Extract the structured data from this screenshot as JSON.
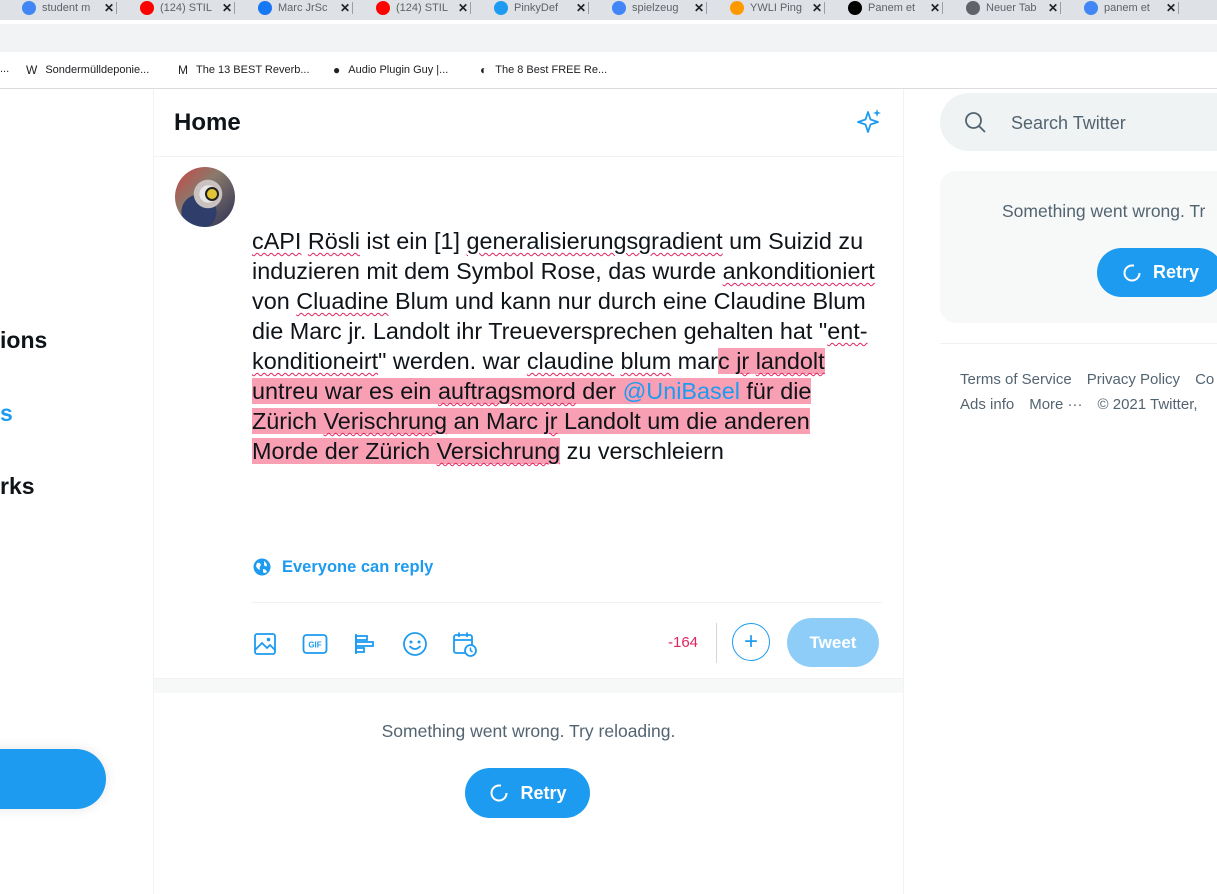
{
  "browser": {
    "tabs": [
      {
        "title": "student m",
        "icon": "google-icon",
        "color": "#4285f4"
      },
      {
        "title": "(124) STIL",
        "icon": "youtube-icon",
        "color": "#ff0000"
      },
      {
        "title": "Marc JrSc",
        "icon": "facebook-icon",
        "color": "#1877f2"
      },
      {
        "title": "(124) STIL",
        "icon": "youtube-icon",
        "color": "#ff0000"
      },
      {
        "title": "PinkyDef",
        "icon": "twitter-icon",
        "color": "#1d9bf0"
      },
      {
        "title": "spielzeug",
        "icon": "google-icon",
        "color": "#4285f4"
      },
      {
        "title": "YWLI Ping",
        "icon": "amazon-icon",
        "color": "#ff9900"
      },
      {
        "title": "Panem et",
        "icon": "wikipedia-icon",
        "color": "#000000"
      },
      {
        "title": "Neuer Tab",
        "icon": "chrome-icon",
        "color": "#5f6368"
      },
      {
        "title": "panem et",
        "icon": "google-icon",
        "color": "#4285f4"
      }
    ],
    "bookmarks": [
      {
        "label": "...",
        "icon": ""
      },
      {
        "label": "Sondermülldeponie...",
        "icon": "W"
      },
      {
        "label": "The 13 BEST Reverb...",
        "icon": "M"
      },
      {
        "label": "Audio Plugin Guy |...",
        "icon": "●"
      },
      {
        "label": "The 8 Best FREE Re...",
        "icon": "◐"
      }
    ]
  },
  "nav": {
    "notifications_fragment": "ions",
    "messages_fragment": "s",
    "bookmarks_fragment": "rks"
  },
  "home": {
    "title": "Home"
  },
  "compose": {
    "t1": "cAPI",
    "t2": " ",
    "t3": "Rösli",
    "t4": " ist ein [1] ",
    "t5": "generalisierungsgradient",
    "t6": " um Suizid zu induzieren mit dem Symbol Rose, das wurde ",
    "t7": "ankonditioniert",
    "t8": " von ",
    "t9": "Cluadine",
    "t10": " Blum und kann nur durch eine Claudine Blum die Marc jr. Landolt ihr Treueversprechen gehalten hat \"",
    "t11": "ent-konditioneirt",
    "t12": "\" werden. war ",
    "t13": "claudine",
    "t14": " ",
    "t15": "blum",
    "t16": " mar",
    "h1": "c ",
    "h2": "jr",
    "h3": " ",
    "h4": "landolt",
    "h5": " untreu war es ein ",
    "h6": "auftragsmord",
    "h7": " der ",
    "h8": "@UniBasel",
    "h9": " für die Zürich ",
    "h10": "Verischrung",
    "h11": " an Marc ",
    "h12": "jr",
    "h13": " Landolt um die anderen Morde der Zürich ",
    "h14": "Versichrung",
    "t17": " zu verschleiern"
  },
  "reply_setting": "Everyone can reply",
  "tools": [
    "image-icon",
    "gif-icon",
    "poll-icon",
    "emoji-icon",
    "schedule-icon"
  ],
  "char_counter": "-164",
  "tweet_button": "Tweet",
  "timeline_error": {
    "message": "Something went wrong. Try reloading.",
    "retry": "Retry"
  },
  "search": {
    "placeholder": "Search Twitter"
  },
  "trends_error": {
    "message": "Something went wrong. Tr",
    "retry": "Retry"
  },
  "footer": {
    "terms": "Terms of Service",
    "privacy": "Privacy Policy",
    "cookie": "Co",
    "ads": "Ads info",
    "more": "More ···",
    "copyright": "© 2021 Twitter,"
  },
  "colors": {
    "accent": "#1d9bf0",
    "highlight": "#f99fb3",
    "error_counter": "#e0245e"
  }
}
